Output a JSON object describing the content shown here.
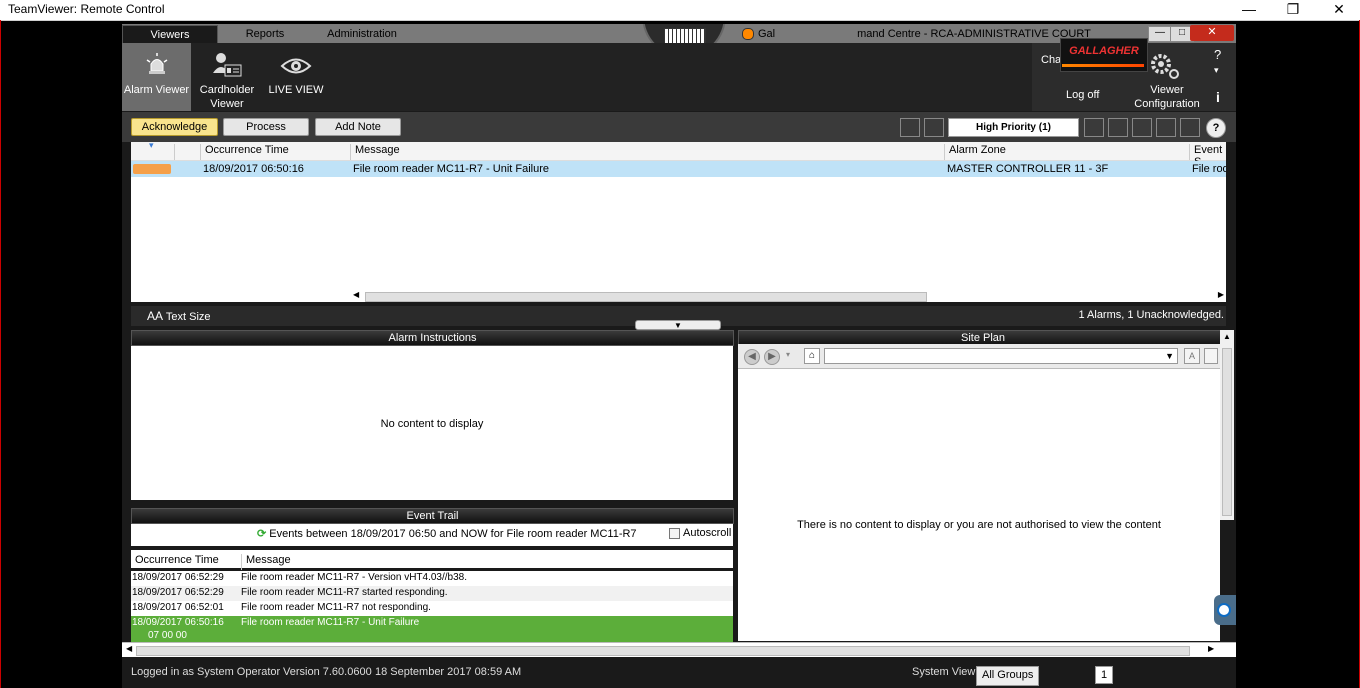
{
  "teamviewer": {
    "title": "TeamViewer: Remote Control",
    "minimize": "—",
    "maximize": "❐",
    "close": "✕"
  },
  "cc": {
    "tabs": [
      {
        "label": "Viewers"
      },
      {
        "label": "Reports"
      },
      {
        "label": "Administration"
      }
    ],
    "title_left": "Gal",
    "title_right": "mand Centre - RCA-ADMINISTRATIVE COURT",
    "min": "—",
    "max": "□",
    "close": "✕"
  },
  "toolbar": {
    "alarm_viewer": "Alarm Viewer",
    "cardholder_viewer_1": "Cardholder",
    "cardholder_viewer_2": "Viewer",
    "live_view": "LIVE VIEW",
    "cha": "Cha",
    "logo": "GALLAGHER",
    "log_off": "Log off",
    "viewer_config_1": "Viewer",
    "viewer_config_2": "Configuration",
    "help": "?",
    "help_arrow": "▾",
    "info": "i"
  },
  "alarm_bar": {
    "acknowledge": "Acknowledge",
    "process": "Process",
    "add_note": "Add Note",
    "high_priority": "High Priority (1)",
    "help": "?"
  },
  "alarm_table": {
    "columns": [
      "Occurrence Time",
      "Message",
      "Alarm Zone",
      "Event S"
    ],
    "rows": [
      {
        "time": "18/09/2017 06:50:16",
        "message": "File room reader MC11-R7 - Unit Failure",
        "zone": "MASTER CONTROLLER 11 - 3F",
        "event": "File roo"
      }
    ],
    "priority_color": "#f5a04a"
  },
  "status": {
    "text_size": "Text Size",
    "text_size_icon": "AA",
    "count": "1 Alarms, 1 Unacknowledged."
  },
  "alarm_instructions": {
    "title": "Alarm Instructions",
    "empty": "No content to display"
  },
  "site_plan": {
    "title": "Site Plan",
    "empty": "There is no content to display or you are not authorised to view the content"
  },
  "event_trail": {
    "title": "Event Trail",
    "summary": "Events between 18/09/2017 06:50 and NOW for File room reader MC11-R7",
    "autoscroll": "Autoscroll",
    "columns": [
      "Occurrence Time",
      "Message"
    ],
    "rows": [
      {
        "time": "18/09/2017 06:52:29",
        "message": "File room reader MC11-R7 - Version vHT4.03//b38."
      },
      {
        "time": "18/09/2017 06:52:29",
        "message": "File room reader MC11-R7 started responding."
      },
      {
        "time": "18/09/2017 06:52:01",
        "message": "File room reader MC11-R7 not responding."
      },
      {
        "time": "18/09/2017 06:50:16",
        "message": "File room reader MC11-R7 - Unit Failure",
        "extra": "07 00 00"
      }
    ],
    "highlight_color": "#5cae3a"
  },
  "footer": {
    "logged_in": "Logged in as System Operator",
    "version": "Version 7.60.0600",
    "date": "18 September 2017 08:59 AM",
    "system_view_label": "System View:",
    "system_view_value": "All Groups",
    "page": "1"
  }
}
